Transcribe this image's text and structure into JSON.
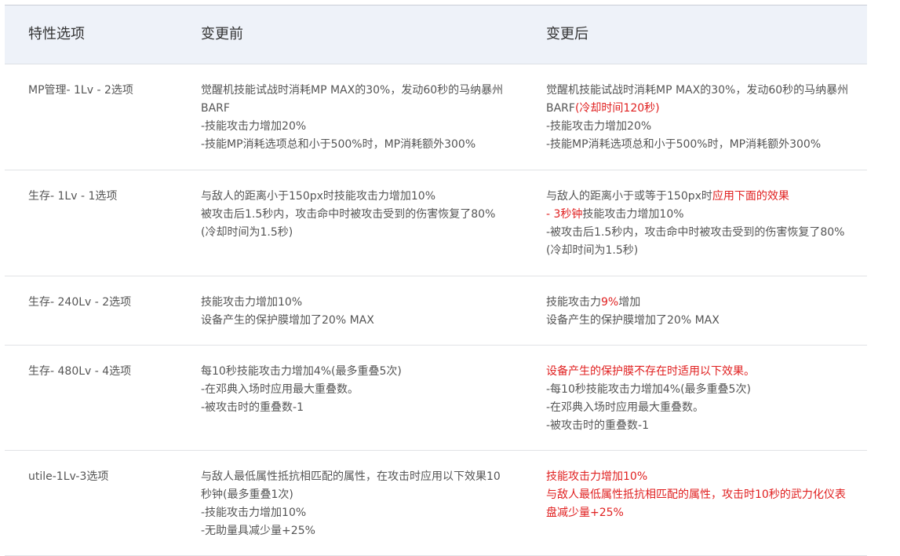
{
  "header": {
    "col1": "特性选项",
    "col2": "变更前",
    "col3": "变更后"
  },
  "rows": [
    {
      "name": "MP管理- 1Lv - 2选项",
      "before": [
        "觉醒机技能试战时消耗MP MAX的30%，发动60秒的马纳暴州",
        "BARF",
        "-技能攻击力增加20%",
        "-技能MP消耗选项总和小于500%时，MP消耗额外300%"
      ],
      "after": {
        "l1": "觉醒机技能试战时消耗MP MAX的30%，发动60秒的马纳暴州",
        "l2a": "BARF",
        "l2b": "(冷却时间120秒)",
        "l3": "-技能攻击力增加20%",
        "l4": "-技能MP消耗选项总和小于500%时，MP消耗额外300%"
      }
    },
    {
      "name": "生存- 1Lv - 1选项",
      "before": [
        "与敌人的距离小于150px时技能攻击力增加10%",
        "被攻击后1.5秒内，攻击命中时被攻击受到的伤害恢复了80%",
        "(冷却时间为1.5秒)"
      ],
      "after": {
        "l1a": "与敌人的距离小于或等于150px时",
        "l1b": "应用下面的效果",
        "l2a": "- 3秒钟",
        "l2b": "技能攻击力增加10%",
        "l3": "-被攻击后1.5秒内，攻击命中时被攻击受到的伤害恢复了80%",
        "l4": "(冷却时间为1.5秒)"
      }
    },
    {
      "name": "生存- 240Lv - 2选项",
      "before": [
        "技能攻击力增加10%",
        "设备产生的保护膜增加了20% MAX"
      ],
      "after": {
        "l1a": "技能攻击力",
        "l1b": "9%",
        "l1c": "增加",
        "l2": "设备产生的保护膜增加了20% MAX"
      }
    },
    {
      "name": "生存- 480Lv - 4选项",
      "before": [
        "每10秒技能攻击力增加4%(最多重叠5次)",
        "-在邓典入场时应用最大重叠数。",
        "-被攻击时的重叠数-1"
      ],
      "after": {
        "l1": "设备产生的保护膜不存在时适用以下效果。",
        "l2": "-每10秒技能攻击力增加4%(最多重叠5次)",
        "l3": "-在邓典入场时应用最大重叠数。",
        "l4": "-被攻击时的重叠数-1"
      }
    },
    {
      "name": "utile-1Lv-3选项",
      "before": [
        "与敌人最低属性抵抗相匹配的属性，在攻击时应用以下效果10",
        "秒钟(最多重叠1次)",
        "-技能攻击力增加10%",
        "-无助量具减少量+25%"
      ],
      "after": {
        "l1": "技能攻击力增加10%",
        "l2": "与敌人最低属性抵抗相匹配的属性，攻击时10秒的武力化仪表",
        "l3": "盘减少量+25%"
      }
    }
  ],
  "colors": {
    "header_bg": "#eef2f9",
    "text": "#555555",
    "highlight": "#e02020"
  }
}
